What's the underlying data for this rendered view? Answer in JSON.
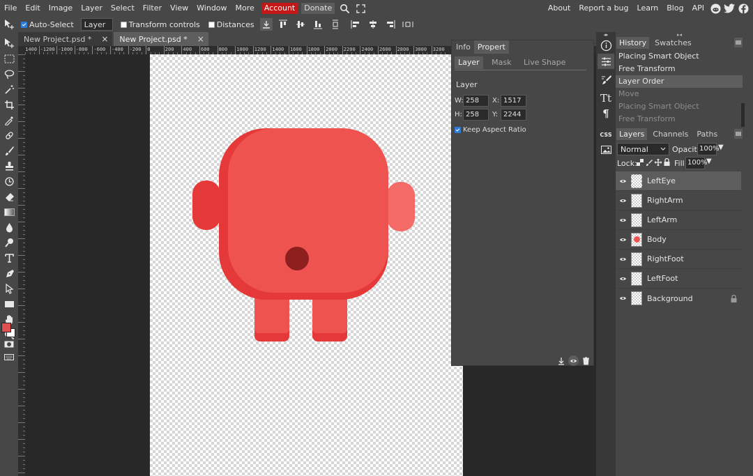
{
  "menu": {
    "items": [
      "File",
      "Edit",
      "Image",
      "Layer",
      "Select",
      "Filter",
      "View",
      "Window",
      "More"
    ],
    "account": "Account",
    "donate": "Donate",
    "right_links": [
      "About",
      "Report a bug",
      "Learn",
      "Blog",
      "API"
    ]
  },
  "options": {
    "auto_select": "Auto-Select",
    "auto_select_checked": true,
    "select_target": "Layer",
    "transform_controls": "Transform controls",
    "distances": "Distances"
  },
  "tabs": [
    {
      "label": "New Project.psd *",
      "close": "×",
      "active": false
    },
    {
      "label": "New Project.psd *",
      "close": "×",
      "active": true
    }
  ],
  "ruler": {
    "top_labels": [
      "-1400",
      "-1200",
      "-1000",
      "-800",
      "-600",
      "-400",
      "-200",
      "0",
      "200",
      "400",
      "600",
      "800",
      "1000",
      "1200",
      "1400",
      "1600",
      "1800",
      "2000",
      "2200",
      "2400",
      "2600",
      "2800",
      "3000",
      "3200"
    ]
  },
  "properties": {
    "tabs": [
      "Info",
      "Propert"
    ],
    "subtabs": [
      "Layer",
      "Mask",
      "Live Shape"
    ],
    "section": "Layer",
    "w_label": "W:",
    "w": "258",
    "x_label": "X:",
    "x": "1517",
    "h_label": "H:",
    "h": "258",
    "y_label": "Y:",
    "y": "2244",
    "keep_aspect": "Keep Aspect Ratio"
  },
  "history": {
    "tabs": [
      "History",
      "Swatches"
    ],
    "items": [
      {
        "label": "Placing Smart Object",
        "state": "normal"
      },
      {
        "label": "Free Transform",
        "state": "normal"
      },
      {
        "label": "Layer Order",
        "state": "selected"
      },
      {
        "label": "Move",
        "state": "dim"
      },
      {
        "label": "Placing Smart Object",
        "state": "dim"
      },
      {
        "label": "Free Transform",
        "state": "dim"
      }
    ]
  },
  "layers_panel": {
    "tabs": [
      "Layers",
      "Channels",
      "Paths"
    ],
    "blend_mode": "Normal",
    "opacity_label": "Opacity:",
    "opacity": "100%",
    "lock_label": "Lock:",
    "fill_label": "Fill:",
    "fill": "100%",
    "layers": [
      {
        "name": "LeftEye",
        "selected": true
      },
      {
        "name": "RightArm",
        "selected": false
      },
      {
        "name": "LeftArm",
        "selected": false
      },
      {
        "name": "Body",
        "selected": false
      },
      {
        "name": "RightFoot",
        "selected": false
      },
      {
        "name": "LeftFoot",
        "selected": false
      },
      {
        "name": "Background",
        "selected": false
      }
    ]
  },
  "strip": {
    "css_label": "CSS"
  },
  "colors": {
    "accent": "#c41818",
    "foreground": "#e05050",
    "background": "#ffffff",
    "character_body": "#ef5350",
    "character_shade": "#e53838",
    "eye": "#8e1f1f"
  }
}
